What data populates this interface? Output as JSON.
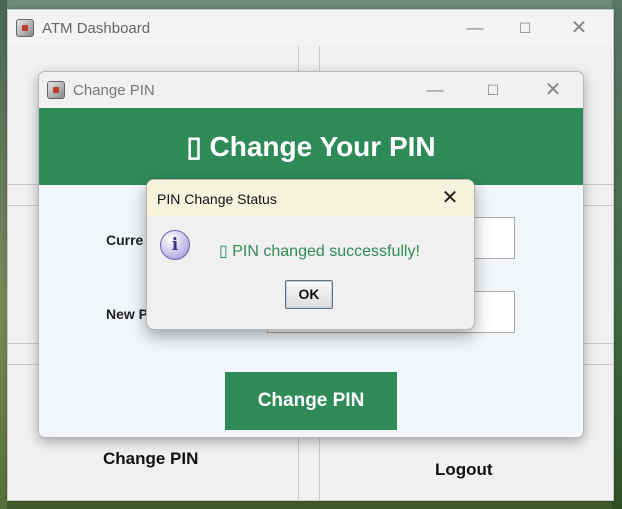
{
  "main_window": {
    "title": "ATM Dashboard",
    "labels": {
      "change_pin": "Change PIN",
      "logout": "Logout"
    }
  },
  "pin_dialog": {
    "title": "Change PIN",
    "header": "▯ Change Your PIN",
    "current_label": "Curre",
    "new_label": "New P",
    "current_value": "",
    "new_value": "",
    "button_label": "Change PIN",
    "accent_color": "#2e8b57"
  },
  "message_dialog": {
    "title": "PIN Change Status",
    "icon": "info-icon",
    "message": "▯ PIN changed successfully!",
    "message_color": "#2e8b57",
    "ok_label": "OK"
  },
  "window_controls": {
    "minimize": "—",
    "maximize": "☐",
    "close": "✕"
  }
}
